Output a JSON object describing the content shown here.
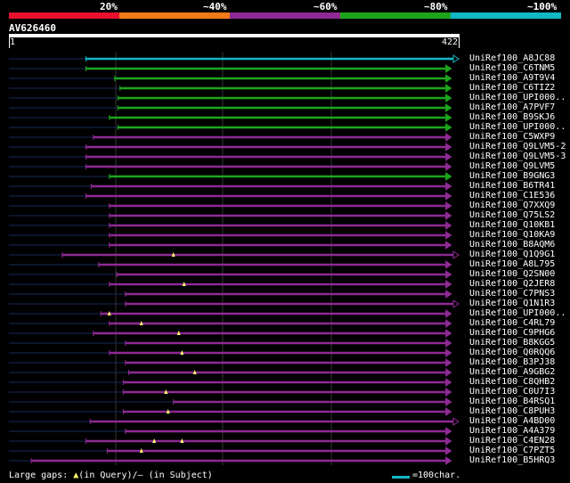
{
  "scale": {
    "labels": [
      "20%",
      "~40%",
      "~60%",
      "~80%",
      "~100%"
    ],
    "colors": [
      "#e8102e",
      "#f07a18",
      "#8e2a94",
      "#1ca51c",
      "#12b8c4"
    ]
  },
  "query": {
    "id": "AV626460",
    "start": "1",
    "end": "422",
    "length": 422
  },
  "footer": {
    "large_gaps": "Large gaps: ",
    "in_query": "(in Query)/",
    "dash": "–",
    "in_subject": " (in Subject)",
    "legend": "=100char."
  },
  "colors": {
    "thin_line": "#1a2a5a",
    "grid": "#333333",
    "gap_marker": "#ffff66"
  },
  "hits": [
    {
      "label": "UniRef100_A8JC88",
      "start": 73,
      "end": 422,
      "cls": "cyan",
      "tail": "end"
    },
    {
      "label": "UniRef100_C6TNM5",
      "start": 73,
      "end": 415,
      "cls": "green",
      "tail": "end"
    },
    {
      "label": "UniRef100_A9T9V4",
      "start": 100,
      "end": 415,
      "cls": "green",
      "tail": "end"
    },
    {
      "label": "UniRef100_C6TIZ2",
      "start": 105,
      "end": 415,
      "cls": "green",
      "tail": "end"
    },
    {
      "label": "UniRef100_UPI000..",
      "start": 103,
      "end": 415,
      "cls": "green",
      "tail": "end"
    },
    {
      "label": "UniRef100_A7PVF7",
      "start": 103,
      "end": 415,
      "cls": "green",
      "tail": "end"
    },
    {
      "label": "UniRef100_B9SKJ6",
      "start": 95,
      "end": 415,
      "cls": "green",
      "tail": "end"
    },
    {
      "label": "UniRef100_UPI000..",
      "start": 103,
      "end": 415,
      "cls": "green",
      "tail": "end"
    },
    {
      "label": "UniRef100_C5WXP9",
      "start": 80,
      "end": 415,
      "cls": "purple",
      "tail": "end"
    },
    {
      "label": "UniRef100_Q9LVM5-2",
      "start": 73,
      "end": 415,
      "cls": "purple",
      "tail": "end"
    },
    {
      "label": "UniRef100_Q9LVM5-3",
      "start": 73,
      "end": 415,
      "cls": "purple",
      "tail": "end"
    },
    {
      "label": "UniRef100_Q9LVM5",
      "start": 73,
      "end": 415,
      "cls": "purple",
      "tail": "end"
    },
    {
      "label": "UniRef100_B9GNG3",
      "start": 95,
      "end": 415,
      "cls": "green",
      "tail": "end"
    },
    {
      "label": "UniRef100_B6TR41",
      "start": 78,
      "end": 415,
      "cls": "purple",
      "tail": "end"
    },
    {
      "label": "UniRef100_C1E536",
      "start": 73,
      "end": 415,
      "cls": "purple",
      "tail": "end"
    },
    {
      "label": "UniRef100_Q7XXQ9",
      "start": 95,
      "end": 415,
      "cls": "purple",
      "tail": "end"
    },
    {
      "label": "UniRef100_Q75LS2",
      "start": 95,
      "end": 415,
      "cls": "purple",
      "tail": "end"
    },
    {
      "label": "UniRef100_Q10KB1",
      "start": 95,
      "end": 415,
      "cls": "purple",
      "tail": "end"
    },
    {
      "label": "UniRef100_Q10KA9",
      "start": 95,
      "end": 415,
      "cls": "purple",
      "tail": "end"
    },
    {
      "label": "UniRef100_B8AQM6",
      "start": 95,
      "end": 415,
      "cls": "purple",
      "tail": "end"
    },
    {
      "label": "UniRef100_Q1Q9G1",
      "start": 51,
      "end": 422,
      "cls": "purple",
      "tail": "end",
      "gap": 155
    },
    {
      "label": "UniRef100_A8L795",
      "start": 85,
      "end": 415,
      "cls": "purple",
      "tail": "end"
    },
    {
      "label": "UniRef100_Q2SN00",
      "start": 102,
      "end": 415,
      "cls": "purple",
      "tail": "end"
    },
    {
      "label": "UniRef100_Q2JER8",
      "start": 95,
      "end": 415,
      "cls": "purple",
      "tail": "end",
      "gap": 165
    },
    {
      "label": "UniRef100_C7PNS3",
      "start": 110,
      "end": 415,
      "cls": "purple",
      "tail": "end"
    },
    {
      "label": "UniRef100_Q1N1R3",
      "start": 110,
      "end": 422,
      "cls": "purple",
      "tail": "end"
    },
    {
      "label": "UniRef100_UPI000..",
      "start": 87,
      "end": 415,
      "cls": "purple",
      "tail": "end",
      "gap": 95
    },
    {
      "label": "UniRef100_C4RL79",
      "start": 95,
      "end": 415,
      "cls": "purple",
      "tail": "end",
      "gap": 125
    },
    {
      "label": "UniRef100_C9PHG6",
      "start": 80,
      "end": 415,
      "cls": "purple",
      "tail": "end",
      "gap": 160
    },
    {
      "label": "UniRef100_B8KGG5",
      "start": 110,
      "end": 415,
      "cls": "purple",
      "tail": "end"
    },
    {
      "label": "UniRef100_Q0RQQ6",
      "start": 95,
      "end": 415,
      "cls": "purple",
      "tail": "end",
      "gap": 163
    },
    {
      "label": "UniRef100_B3PJ38",
      "start": 110,
      "end": 415,
      "cls": "purple",
      "tail": "end"
    },
    {
      "label": "UniRef100_A9GBG2",
      "start": 113,
      "end": 415,
      "cls": "purple",
      "tail": "end",
      "gap": 175
    },
    {
      "label": "UniRef100_C8QHB2",
      "start": 108,
      "end": 415,
      "cls": "purple",
      "tail": "end"
    },
    {
      "label": "UniRef100_C0U7I3",
      "start": 108,
      "end": 415,
      "cls": "purple",
      "tail": "end",
      "gap": 148
    },
    {
      "label": "UniRef100_B4RSQ1",
      "start": 155,
      "end": 415,
      "cls": "purple",
      "tail": "end"
    },
    {
      "label": "UniRef100_C8PUH3",
      "start": 108,
      "end": 415,
      "cls": "purple",
      "tail": "end",
      "gap": 150
    },
    {
      "label": "UniRef100_A4BD00",
      "start": 77,
      "end": 422,
      "cls": "purple",
      "tail": "end"
    },
    {
      "label": "UniRef100_A4A379",
      "start": 110,
      "end": 415,
      "cls": "purple",
      "tail": "end"
    },
    {
      "label": "UniRef100_C4EN28",
      "start": 73,
      "end": 415,
      "cls": "purple",
      "tail": "end",
      "gap": 137,
      "gap2": 163
    },
    {
      "label": "UniRef100_C7PZT5",
      "start": 93,
      "end": 415,
      "cls": "purple",
      "tail": "end",
      "gap": 125
    },
    {
      "label": "UniRef100_B5HRQ3",
      "start": 22,
      "end": 415,
      "cls": "purple",
      "tail": "end"
    }
  ]
}
